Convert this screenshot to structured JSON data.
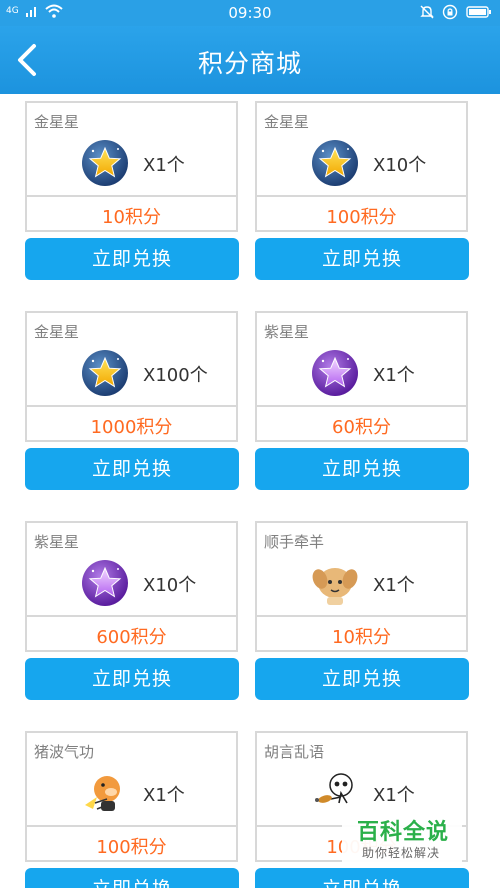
{
  "status_bar": {
    "time": "09:30",
    "signal_label": "4G"
  },
  "header": {
    "title": "积分商城"
  },
  "redeem_label": "立即兑换",
  "items": [
    {
      "name": "金星星",
      "icon": "gold-star",
      "quantity": "X1个",
      "points": "10积分"
    },
    {
      "name": "金星星",
      "icon": "gold-star",
      "quantity": "X10个",
      "points": "100积分"
    },
    {
      "name": "金星星",
      "icon": "gold-star",
      "quantity": "X100个",
      "points": "1000积分"
    },
    {
      "name": "紫星星",
      "icon": "purple-star",
      "quantity": "X1个",
      "points": "60积分"
    },
    {
      "name": "紫星星",
      "icon": "purple-star",
      "quantity": "X10个",
      "points": "600积分"
    },
    {
      "name": "顺手牵羊",
      "icon": "sheep-emoticon",
      "quantity": "X1个",
      "points": "10积分"
    },
    {
      "name": "猪波气功",
      "icon": "pig-emoticon",
      "quantity": "X1个",
      "points": "100积分"
    },
    {
      "name": "胡言乱语",
      "icon": "babble-emoticon",
      "quantity": "X1个",
      "points": "100积分"
    }
  ],
  "watermark": {
    "main": "百科全说",
    "sub": "助你轻松解决"
  },
  "colors": {
    "header": "#1c93de",
    "button": "#16a6ee",
    "points": "#ff6a21",
    "border": "#d8d8d8"
  }
}
